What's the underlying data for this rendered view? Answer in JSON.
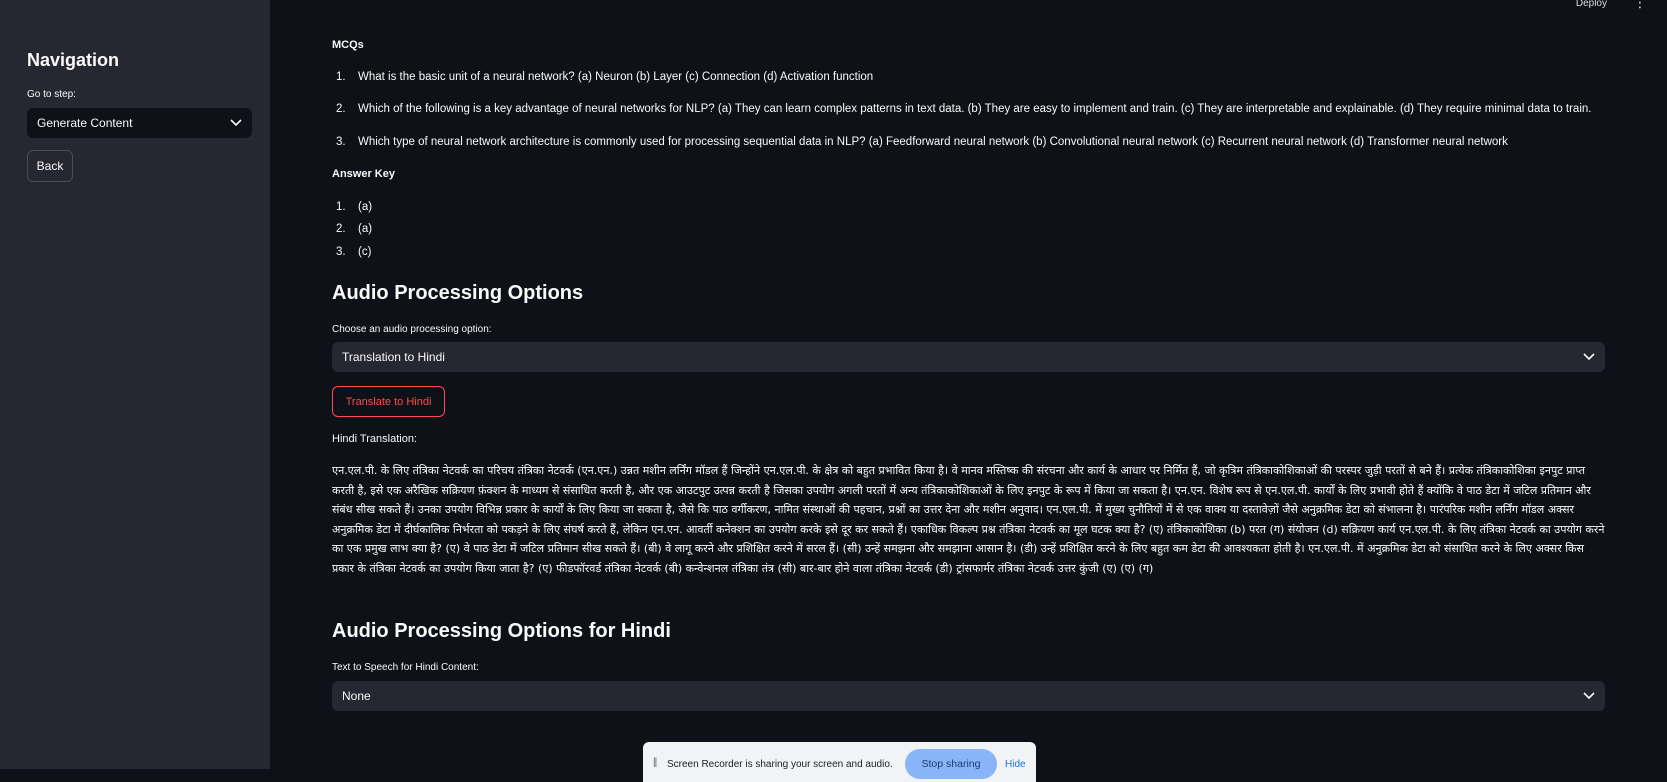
{
  "header": {
    "deploy_label": "Deploy",
    "menu_icon": "kebab-menu-icon"
  },
  "sidebar": {
    "title": "Navigation",
    "goto_label": "Go to step:",
    "step_select_value": "Generate Content",
    "back_label": "Back"
  },
  "mcqs": {
    "heading": "MCQs",
    "items": [
      {
        "num": "1.",
        "text": "What is the basic unit of a neural network? (a) Neuron (b) Layer (c) Connection (d) Activation function"
      },
      {
        "num": "2.",
        "text": "Which of the following is a key advantage of neural networks for NLP? (a) They can learn complex patterns in text data. (b) They are easy to implement and train. (c) They are interpretable and explainable. (d) They require minimal data to train."
      },
      {
        "num": "3.",
        "text": "Which type of neural network architecture is commonly used for processing sequential data in NLP? (a) Feedforward neural network (b) Convolutional neural network (c) Recurrent neural network (d) Transformer neural network"
      }
    ]
  },
  "answer_key": {
    "heading": "Answer Key",
    "items": [
      {
        "num": "1.",
        "text": "(a)"
      },
      {
        "num": "2.",
        "text": "(a)"
      },
      {
        "num": "3.",
        "text": "(c)"
      }
    ]
  },
  "audio": {
    "heading": "Audio Processing Options",
    "choose_label": "Choose an audio processing option:",
    "select_value": "Translation to Hindi",
    "translate_button": "Translate to Hindi",
    "translation_label": "Hindi Translation:",
    "translation_text": "एन.एल.पी. के लिए तंत्रिका नेटवर्क का परिचय तंत्रिका नेटवर्क (एन.एन.) उन्नत मशीन लर्निंग मॉडल हैं जिन्होंने एन.एल.पी. के क्षेत्र को बहुत प्रभावित किया है। वे मानव मस्तिष्क की संरचना और कार्य के आधार पर निर्मित हैं, जो कृत्रिम तंत्रिकाकोशिकाओं की परस्पर जुड़ी परतों से बने हैं। प्रत्येक तंत्रिकाकोशिका इनपुट प्राप्त करती है, इसे एक अरैखिक सक्रियण फ़ंक्शन के माध्यम से संसाधित करती है, और एक आउटपुट उत्पन्न करती है जिसका उपयोग अगली परतों में अन्य तंत्रिकाकोशिकाओं के लिए इनपुट के रूप में किया जा सकता है। एन.एन. विशेष रूप से एन.एल.पी. कार्यों के लिए प्रभावी होते हैं क्योंकि वे पाठ डेटा में जटिल प्रतिमान और संबंध सीख सकते हैं। उनका उपयोग विभिन्न प्रकार के कार्यों के लिए किया जा सकता है, जैसे कि पाठ वर्गीकरण, नामित संस्थाओं की पहचान, प्रश्नों का उत्तर देना और मशीन अनुवाद। एन.एल.पी. में मुख्य चुनौतियों में से एक वाक्य या दस्तावेज़ों जैसे अनुक्रमिक डेटा को संभालना है। पारंपरिक मशीन लर्निंग मॉडल अक्सर अनुक्रमिक डेटा में दीर्घकालिक निर्भरता को पकड़ने के लिए संघर्ष करते हैं, लेकिन एन.एन. आवर्ती कनेक्शन का उपयोग करके इसे दूर कर सकते हैं। एकाधिक विकल्प प्रश्न तंत्रिका नेटवर्क का मूल घटक क्या है? (ए) तंत्रिकाकोशिका (b) परत (ग) संयोजन (d) सक्रियण कार्य एन.एल.पी. के लिए तंत्रिका नेटवर्क का उपयोग करने का एक प्रमुख लाभ क्या है? (ए) वे पाठ डेटा में जटिल प्रतिमान सीख सकते हैं। (बी) वे लागू करने और प्रशिक्षित करने में सरल हैं। (सी) उन्हें समझना और समझाना आसान है। (डी) उन्हें प्रशिक्षित करने के लिए बहुत कम डेटा की आवश्यकता होती है। एन.एल.पी. में अनुक्रमिक डेटा को संसाधित करने के लिए अक्सर किस प्रकार के तंत्रिका नेटवर्क का उपयोग किया जाता है? (ए) फीडफॉरवर्ड तंत्रिका नेटवर्क (बी) कन्वेन्शनल तंत्रिका तंत्र (सी) बार-बार होने वाला तंत्रिका नेटवर्क (डी) ट्रांसफार्मर तंत्रिका नेटवर्क उत्तर कुंजी (ए) (ए) (ग)"
  },
  "audio_hindi": {
    "heading": "Audio Processing Options for Hindi",
    "tts_label": "Text to Speech for Hindi Content:",
    "select_value": "None"
  },
  "recorder": {
    "message": "Screen Recorder is sharing your screen and audio.",
    "stop_label": "Stop sharing",
    "hide_label": "Hide"
  }
}
